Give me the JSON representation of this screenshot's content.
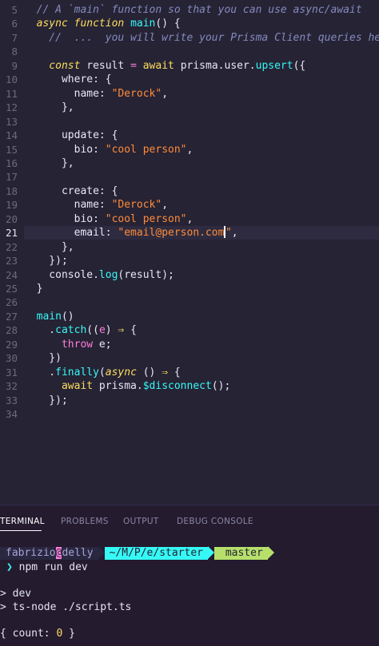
{
  "editor": {
    "active_line": "21",
    "lines": [
      {
        "n": "5",
        "tokens": [
          {
            "c": "cm",
            "t": "  // A `main` function so that you can use async/await"
          }
        ]
      },
      {
        "n": "6",
        "tokens": [
          {
            "c": "kwi",
            "t": "  async function "
          },
          {
            "c": "fn",
            "t": "main"
          },
          {
            "c": "txt",
            "t": "() {"
          }
        ]
      },
      {
        "n": "7",
        "tokens": [
          {
            "c": "cm",
            "t": "    //  ...  you will write your Prisma Client queries here"
          }
        ]
      },
      {
        "n": "8",
        "tokens": []
      },
      {
        "n": "9",
        "tokens": [
          {
            "c": "kwi",
            "t": "    const "
          },
          {
            "c": "txt",
            "t": "result "
          },
          {
            "c": "var",
            "t": "= "
          },
          {
            "c": "kw",
            "t": "await "
          },
          {
            "c": "txt",
            "t": "prisma.user."
          },
          {
            "c": "fn",
            "t": "upsert"
          },
          {
            "c": "txt",
            "t": "({"
          }
        ]
      },
      {
        "n": "10",
        "tokens": [
          {
            "c": "txt",
            "t": "      where: {"
          }
        ]
      },
      {
        "n": "11",
        "tokens": [
          {
            "c": "txt",
            "t": "        name: "
          },
          {
            "c": "str",
            "t": "\"Derock\""
          },
          {
            "c": "txt",
            "t": ","
          }
        ]
      },
      {
        "n": "12",
        "tokens": [
          {
            "c": "txt",
            "t": "      },"
          }
        ]
      },
      {
        "n": "13",
        "tokens": []
      },
      {
        "n": "14",
        "tokens": [
          {
            "c": "txt",
            "t": "      update: {"
          }
        ]
      },
      {
        "n": "15",
        "tokens": [
          {
            "c": "txt",
            "t": "        bio: "
          },
          {
            "c": "str",
            "t": "\"cool person\""
          },
          {
            "c": "txt",
            "t": ","
          }
        ]
      },
      {
        "n": "16",
        "tokens": [
          {
            "c": "txt",
            "t": "      },"
          }
        ]
      },
      {
        "n": "17",
        "tokens": []
      },
      {
        "n": "18",
        "tokens": [
          {
            "c": "txt",
            "t": "      create: {"
          }
        ]
      },
      {
        "n": "19",
        "tokens": [
          {
            "c": "txt",
            "t": "        name: "
          },
          {
            "c": "str",
            "t": "\"Derock\""
          },
          {
            "c": "txt",
            "t": ","
          }
        ]
      },
      {
        "n": "20",
        "tokens": [
          {
            "c": "txt",
            "t": "        bio: "
          },
          {
            "c": "str",
            "t": "\"cool person\""
          },
          {
            "c": "txt",
            "t": ","
          }
        ]
      },
      {
        "n": "21",
        "tokens": [
          {
            "c": "txt",
            "t": "        email: "
          },
          {
            "c": "str",
            "t": "\"email@person.com"
          },
          {
            "c": "cursor",
            "t": ""
          },
          {
            "c": "str",
            "t": "\""
          },
          {
            "c": "txt",
            "t": ","
          }
        ]
      },
      {
        "n": "22",
        "tokens": [
          {
            "c": "txt",
            "t": "      },"
          }
        ]
      },
      {
        "n": "23",
        "tokens": [
          {
            "c": "txt",
            "t": "    });"
          }
        ]
      },
      {
        "n": "24",
        "tokens": [
          {
            "c": "txt",
            "t": "    console."
          },
          {
            "c": "fn",
            "t": "log"
          },
          {
            "c": "txt",
            "t": "(result);"
          }
        ]
      },
      {
        "n": "25",
        "tokens": [
          {
            "c": "txt",
            "t": "  }"
          }
        ]
      },
      {
        "n": "26",
        "tokens": []
      },
      {
        "n": "27",
        "tokens": [
          {
            "c": "fn",
            "t": "  main"
          },
          {
            "c": "txt",
            "t": "()"
          }
        ]
      },
      {
        "n": "28",
        "tokens": [
          {
            "c": "txt",
            "t": "    ."
          },
          {
            "c": "fn",
            "t": "catch"
          },
          {
            "c": "txt",
            "t": "(("
          },
          {
            "c": "var",
            "t": "e"
          },
          {
            "c": "txt",
            "t": ") "
          },
          {
            "c": "arrow",
            "t": "⇒"
          },
          {
            "c": "txt",
            "t": " {"
          }
        ]
      },
      {
        "n": "29",
        "tokens": [
          {
            "c": "var",
            "t": "      throw "
          },
          {
            "c": "txt",
            "t": "e;"
          }
        ]
      },
      {
        "n": "30",
        "tokens": [
          {
            "c": "txt",
            "t": "    })"
          }
        ]
      },
      {
        "n": "31",
        "tokens": [
          {
            "c": "txt",
            "t": "    ."
          },
          {
            "c": "fn",
            "t": "finally"
          },
          {
            "c": "txt",
            "t": "("
          },
          {
            "c": "kwi",
            "t": "async"
          },
          {
            "c": "txt",
            "t": " () "
          },
          {
            "c": "arrow",
            "t": "⇒"
          },
          {
            "c": "txt",
            "t": " {"
          }
        ]
      },
      {
        "n": "32",
        "tokens": [
          {
            "c": "kw",
            "t": "      await "
          },
          {
            "c": "txt",
            "t": "prisma."
          },
          {
            "c": "fn",
            "t": "$disconnect"
          },
          {
            "c": "txt",
            "t": "();"
          }
        ]
      },
      {
        "n": "33",
        "tokens": [
          {
            "c": "txt",
            "t": "    });"
          }
        ]
      },
      {
        "n": "34",
        "tokens": []
      }
    ]
  },
  "panel": {
    "tabs": [
      "TERMINAL",
      "PROBLEMS",
      "OUTPUT",
      "DEBUG CONSOLE"
    ],
    "active_tab": "TERMINAL"
  },
  "terminal": {
    "prompt": {
      "user": "fabrizio",
      "at": "@",
      "host": "delly",
      "path": "~/M/P/e/starter",
      "git_icon": "",
      "branch": "master"
    },
    "prompt_char": "❯",
    "command": "npm run dev",
    "output": [
      "> dev",
      "> ts-node ./script.ts",
      "",
      "{ count: 0 }"
    ],
    "count_value": "0"
  },
  "colors": {
    "editor_bg": "#262335",
    "panel_bg": "#241b2f",
    "keyword": "#fede5d",
    "function": "#36f9f6",
    "string": "#ff8b39",
    "variable": "#ff7edb",
    "comment": "#848bbd",
    "git_segment": "#b6e06b",
    "path_segment": "#36f9f6"
  }
}
